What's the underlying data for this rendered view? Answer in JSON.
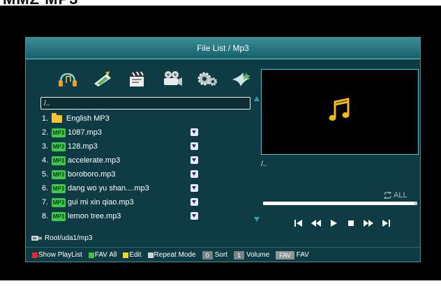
{
  "header": {
    "title": "File List / Mp3"
  },
  "browser": {
    "path": "/..",
    "items": [
      {
        "index": "1.",
        "type": "folder",
        "name": "English MP3"
      },
      {
        "index": "2.",
        "type": "mp3",
        "badge": "MP3",
        "name": "1087.mp3",
        "fav": true
      },
      {
        "index": "3.",
        "type": "mp3",
        "badge": "MP3",
        "name": "128.mp3",
        "fav": true
      },
      {
        "index": "4.",
        "type": "mp3",
        "badge": "MP3",
        "name": "accelerate.mp3",
        "fav": true
      },
      {
        "index": "5.",
        "type": "mp3",
        "badge": "MP3",
        "name": "boroboro.mp3",
        "fav": true
      },
      {
        "index": "6.",
        "type": "mp3",
        "badge": "MP3",
        "name": "dang wo yu shan....mp3",
        "fav": true
      },
      {
        "index": "7.",
        "type": "mp3",
        "badge": "MP3",
        "name": "gui mi xin qiao.mp3",
        "fav": true
      },
      {
        "index": "8.",
        "type": "mp3",
        "badge": "MP3",
        "name": "lemon tree.mp3",
        "fav": true
      }
    ],
    "usb_path": "Root/uda1/mp3"
  },
  "categories": [
    "music-icon",
    "picture-icon",
    "movie-icon",
    "record-icon",
    "settings-icon",
    "effects-icon"
  ],
  "player": {
    "preview_path": "/..",
    "repeat_mode": "ALL",
    "progress": 0.98,
    "controls": [
      "previous-icon",
      "rewind-icon",
      "play-icon",
      "stop-icon",
      "fast-forward-icon",
      "next-icon"
    ]
  },
  "footer": {
    "show_playlist": "Show PlayList",
    "fav_all": "FAV All",
    "edit": "Edit",
    "repeat_mode": "Repeat Mode",
    "sort_key": "0",
    "sort": "Sort",
    "volume_key": "1",
    "volume": "Volume",
    "fav_key": "FAV",
    "fav": "FAV"
  },
  "colors": {
    "panel": "#0f3c44",
    "header": "#2b7f8a",
    "accent": "#33cfe0",
    "mp3_badge": "#3fc94a",
    "folder": "#f7c233",
    "note": "#f5b81c",
    "red_key": "#e8262c",
    "green_key": "#3cc23f",
    "yellow_key": "#f2d42a"
  }
}
